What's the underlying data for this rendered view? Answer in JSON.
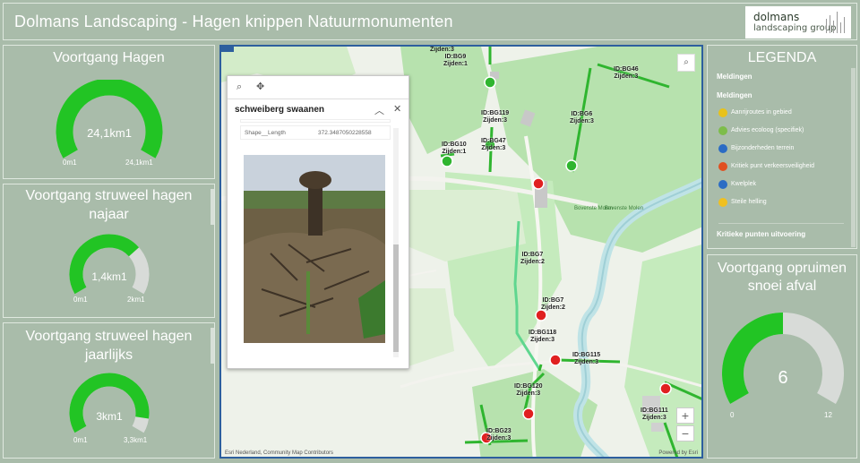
{
  "header": {
    "title": "Dolmans Landscaping - Hagen knippen Natuurmonumenten",
    "logo_line1": "dolmans",
    "logo_line2": "landscaping group"
  },
  "gauges": [
    {
      "title": "Voortgang Hagen",
      "value_label": "24,1km1",
      "min_label": "0m1",
      "max_label": "24,1km1",
      "fraction": 1.0,
      "color": "#22c424"
    },
    {
      "title_line1": "Voortgang struweel hagen",
      "title_line2": "najaar",
      "value_label": "1,4km1",
      "min_label": "0m1",
      "max_label": "2km1",
      "fraction": 0.7,
      "color": "#22c424"
    },
    {
      "title_line1": "Voortgang struweel hagen",
      "title_line2": "jaarlijks",
      "value_label": "3km1",
      "min_label": "0m1",
      "max_label": "3,3km1",
      "fraction": 0.91,
      "color": "#22c424"
    },
    {
      "title_line1": "Voortgang opruimen",
      "title_line2": "snoei afval",
      "value_label": "6",
      "min_label": "0",
      "max_label": "12",
      "fraction": 0.5,
      "color": "#22c424"
    }
  ],
  "popup": {
    "name": "schweiberg swaanen",
    "field_name": "Shape__Length",
    "field_value": "372.3487050228558"
  },
  "map": {
    "attribution": "Esri Nederland, Community Map Contributors",
    "powered": "Powered by Esri",
    "labels": [
      {
        "id": "ID:BG9",
        "z": "Zijden:1"
      },
      {
        "id": "ID:BG46",
        "z": "Zijden:3"
      },
      {
        "id": "ID:BG119",
        "z": "Zijden:3"
      },
      {
        "id": "ID:BG6",
        "z": "Zijden:3"
      },
      {
        "id": "ID:BG10",
        "z": "Zijden:1"
      },
      {
        "id": "ID:BG47",
        "z": "Zijden:3"
      },
      {
        "id": "ID:BG7",
        "z": "Zijden:2"
      },
      {
        "id": "ID:BG7",
        "z": "Zijden:2"
      },
      {
        "id": "ID:BG118",
        "z": "Zijden:3"
      },
      {
        "id": "ID:BG115",
        "z": "Zijden:3"
      },
      {
        "id": "ID:BG120",
        "z": "Zijden:3"
      },
      {
        "id": "ID:BG111",
        "z": "Zijden:3"
      },
      {
        "id": "ID:BG23",
        "z": "Zijden:3"
      }
    ],
    "top_label": "Zijden:3",
    "place1": "Bovenste Molen",
    "place2": "Bovenste Molen"
  },
  "legend": {
    "title": "LEGENDA",
    "section1": "Meldingen",
    "section2": "Meldingen",
    "items": [
      {
        "label": "Aanrijroutes in gebied",
        "color": "#e8c21a"
      },
      {
        "label": "Advies ecoloog (specifiek)",
        "color": "#7dbd4a"
      },
      {
        "label": "Bijzonderheden terrein",
        "color": "#2b6cc4"
      },
      {
        "label": "Kritiek punt verkeersveiligheid",
        "color": "#e05020"
      },
      {
        "label": "Kwelplek",
        "color": "#2b6cc4"
      },
      {
        "label": "Steile helling",
        "color": "#f0c020"
      }
    ],
    "section3": "Kritieke punten uitvoering"
  }
}
